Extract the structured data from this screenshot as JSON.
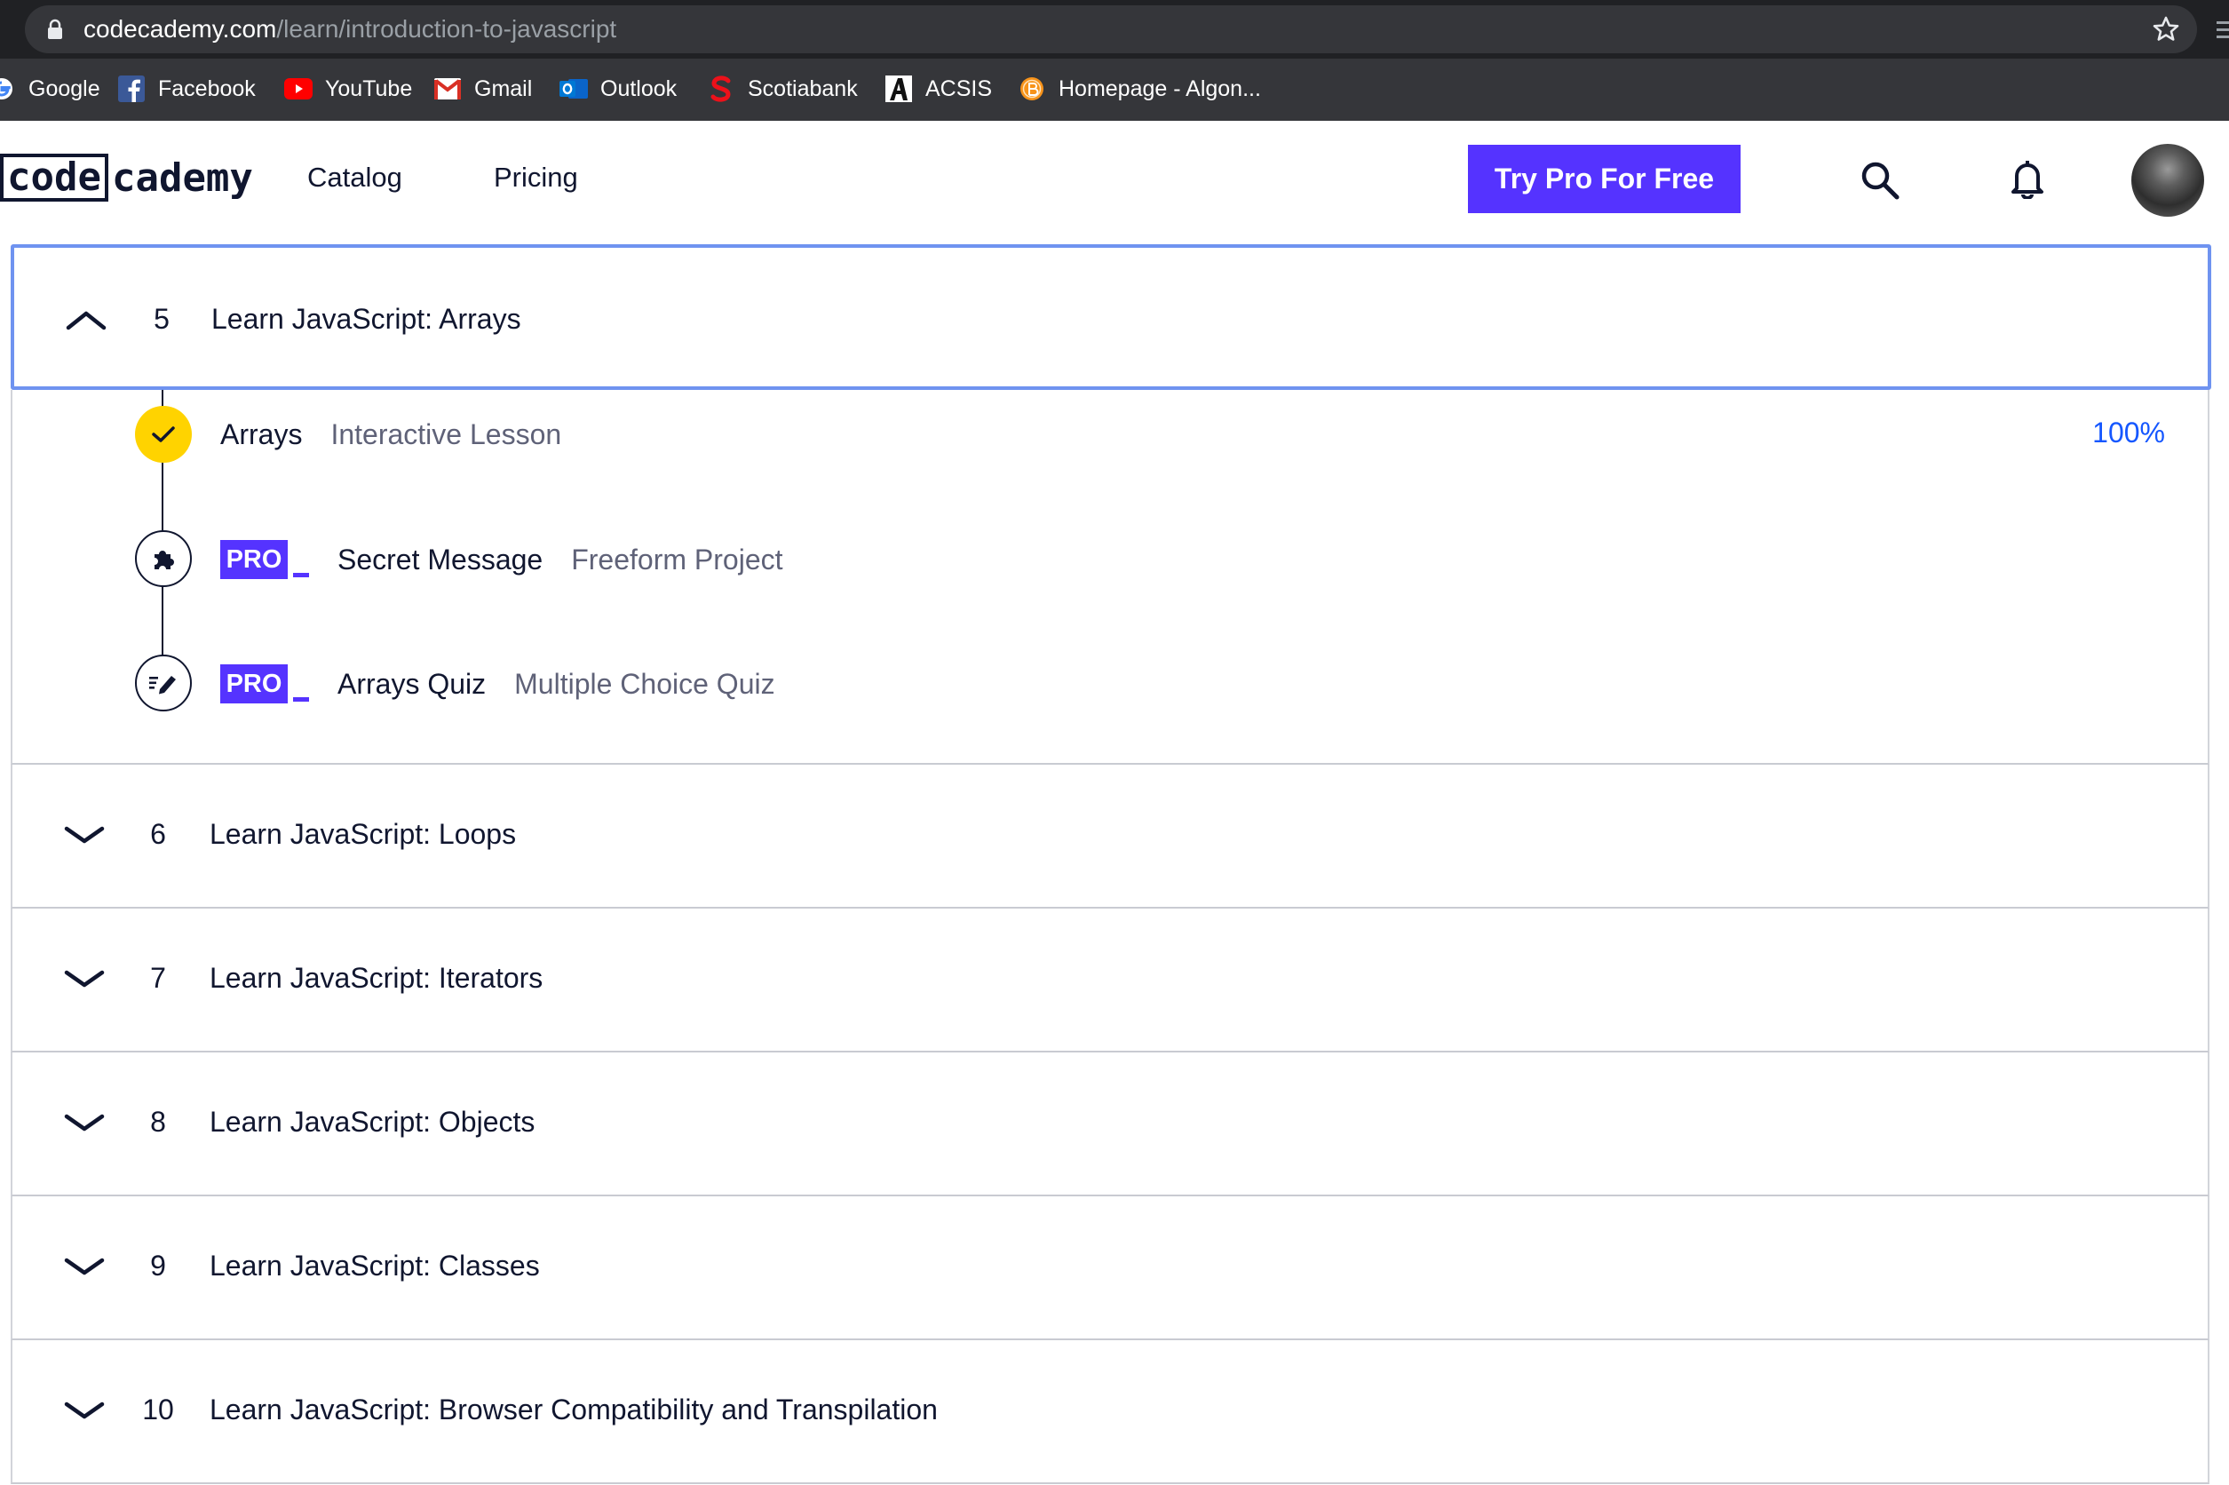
{
  "browser": {
    "url_host": "codecademy.com",
    "url_path": "/learn/introduction-to-javascript",
    "bookmarks": [
      {
        "label": "Google",
        "icon": "google-icon"
      },
      {
        "label": "Facebook",
        "icon": "facebook-icon"
      },
      {
        "label": "YouTube",
        "icon": "youtube-icon"
      },
      {
        "label": "Gmail",
        "icon": "gmail-icon"
      },
      {
        "label": "Outlook",
        "icon": "outlook-icon"
      },
      {
        "label": "Scotiabank",
        "icon": "scotiabank-icon"
      },
      {
        "label": "ACSIS",
        "icon": "acsis-icon"
      },
      {
        "label": "Homepage - Algon...",
        "icon": "bitcoin-icon"
      }
    ]
  },
  "header": {
    "logo_part1": "code",
    "logo_part2": "cademy",
    "nav": [
      "Catalog",
      "Pricing"
    ],
    "cta_label": "Try Pro For Free",
    "icons": [
      "search-icon",
      "bell-icon",
      "avatar"
    ]
  },
  "syllabus": {
    "open_module": {
      "number": "5",
      "title": "Learn JavaScript: Arrays",
      "lessons": [
        {
          "name": "Arrays",
          "type": "Interactive Lesson",
          "progress": "100%",
          "status": "completed",
          "icon": "check-icon"
        },
        {
          "name": "Secret Message",
          "type": "Freeform Project",
          "pro": "PRO",
          "icon": "puzzle-icon"
        },
        {
          "name": "Arrays Quiz",
          "type": "Multiple Choice Quiz",
          "pro": "PRO",
          "icon": "pencil-quiz-icon"
        }
      ]
    },
    "modules": [
      {
        "number": "6",
        "title": "Learn JavaScript: Loops"
      },
      {
        "number": "7",
        "title": "Learn JavaScript: Iterators"
      },
      {
        "number": "8",
        "title": "Learn JavaScript: Objects"
      },
      {
        "number": "9",
        "title": "Learn JavaScript: Classes"
      },
      {
        "number": "10",
        "title": "Learn JavaScript: Browser Compatibility and Transpilation"
      }
    ]
  },
  "colors": {
    "brand_purple": "#5533ff",
    "completed_yellow": "#ffd300",
    "progress_blue": "#1557ff",
    "focus_outline": "#6f93f0",
    "navy_text": "#10162f"
  }
}
